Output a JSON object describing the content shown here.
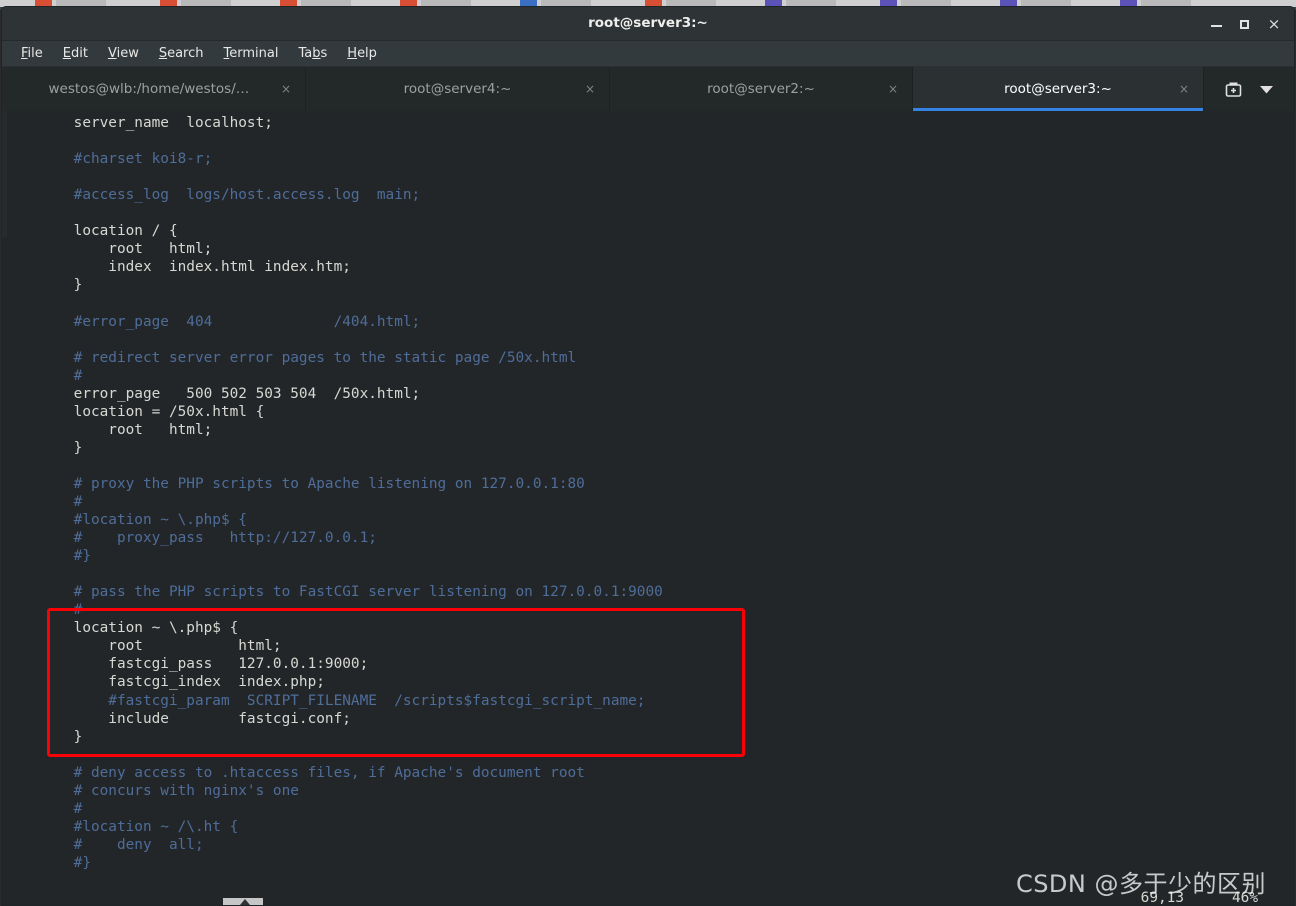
{
  "window": {
    "title": "root@server3:~",
    "buttons": {
      "minimize": "minimize",
      "maximize": "maximize",
      "close": "×"
    }
  },
  "menubar": {
    "items": [
      {
        "label": "File",
        "mnemonic": "F"
      },
      {
        "label": "Edit",
        "mnemonic": "E"
      },
      {
        "label": "View",
        "mnemonic": "V"
      },
      {
        "label": "Search",
        "mnemonic": "S"
      },
      {
        "label": "Terminal",
        "mnemonic": "T"
      },
      {
        "label": "Tabs",
        "mnemonic": "b"
      },
      {
        "label": "Help",
        "mnemonic": "H"
      }
    ]
  },
  "tabs": {
    "items": [
      {
        "label": "westos@wlb:/home/westos/Dow…",
        "active": false,
        "close": "×"
      },
      {
        "label": "root@server4:~",
        "active": false,
        "close": "×"
      },
      {
        "label": "root@server2:~",
        "active": false,
        "close": "×"
      },
      {
        "label": "root@server3:~",
        "active": true,
        "close": "×"
      }
    ],
    "new_tab_icon": "new-tab-icon",
    "tab_list_icon": "chevron-down-icon",
    "active_underline_color": "#3584e4"
  },
  "terminal": {
    "editor": "vim",
    "colors": {
      "background": "#222629",
      "foreground": "#d8d8d2",
      "comment": "#4f6d99"
    },
    "lines": [
      {
        "text": "    server_name  localhost;",
        "comment": false
      },
      {
        "text": "",
        "comment": false
      },
      {
        "text": "    #charset koi8-r;",
        "comment": true
      },
      {
        "text": "",
        "comment": false
      },
      {
        "text": "    #access_log  logs/host.access.log  main;",
        "comment": true
      },
      {
        "text": "",
        "comment": false
      },
      {
        "text": "    location / {",
        "comment": false
      },
      {
        "text": "        root   html;",
        "comment": false
      },
      {
        "text": "        index  index.html index.htm;",
        "comment": false
      },
      {
        "text": "    }",
        "comment": false
      },
      {
        "text": "",
        "comment": false
      },
      {
        "text": "    #error_page  404              /404.html;",
        "comment": true
      },
      {
        "text": "",
        "comment": false
      },
      {
        "text": "    # redirect server error pages to the static page /50x.html",
        "comment": true
      },
      {
        "text": "    #",
        "comment": true
      },
      {
        "text": "    error_page   500 502 503 504  /50x.html;",
        "comment": false
      },
      {
        "text": "    location = /50x.html {",
        "comment": false
      },
      {
        "text": "        root   html;",
        "comment": false
      },
      {
        "text": "    }",
        "comment": false
      },
      {
        "text": "",
        "comment": false
      },
      {
        "text": "    # proxy the PHP scripts to Apache listening on 127.0.0.1:80",
        "comment": true
      },
      {
        "text": "    #",
        "comment": true
      },
      {
        "text": "    #location ~ \\.php$ {",
        "comment": true
      },
      {
        "text": "    #    proxy_pass   http://127.0.0.1;",
        "comment": true
      },
      {
        "text": "    #}",
        "comment": true
      },
      {
        "text": "",
        "comment": false
      },
      {
        "text": "    # pass the PHP scripts to FastCGI server listening on 127.0.0.1:9000",
        "comment": true
      },
      {
        "text": "    #",
        "comment": true
      },
      {
        "text": "    location ~ \\.php$ {",
        "comment": false
      },
      {
        "text": "        root           html;",
        "comment": false
      },
      {
        "text": "        fastcgi_pass   127.0.0.1:9000;",
        "comment": false
      },
      {
        "text": "        fastcgi_index  index.php;",
        "comment": false
      },
      {
        "text": "        #fastcgi_param  SCRIPT_FILENAME  /scripts$fastcgi_script_name;",
        "comment": true
      },
      {
        "text": "        include        fastcgi.conf;",
        "comment": false
      },
      {
        "text": "    }",
        "comment": false
      },
      {
        "text": "",
        "comment": false
      },
      {
        "text": "    # deny access to .htaccess files, if Apache's document root",
        "comment": true
      },
      {
        "text": "    # concurs with nginx's one",
        "comment": true
      },
      {
        "text": "    #",
        "comment": true
      },
      {
        "text": "    #location ~ /\\.ht {",
        "comment": true
      },
      {
        "text": "    #    deny  all;",
        "comment": true
      },
      {
        "text": "    #}",
        "comment": true
      },
      {
        "text": "",
        "comment": false
      },
      {
        "text": "}",
        "comment": false
      }
    ],
    "status": {
      "position": "69,13",
      "percent": "46%"
    }
  },
  "annotation": {
    "red_box_color": "#fb0007",
    "target_label": "fastcgi-location-block"
  },
  "watermark": {
    "text": "CSDN @多于少的区别"
  }
}
